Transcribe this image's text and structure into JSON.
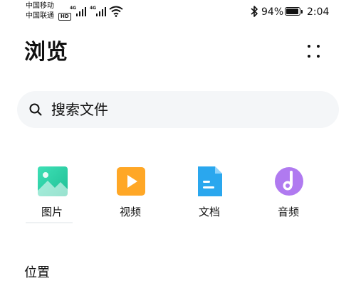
{
  "status_bar": {
    "carrier_1": "中国移动",
    "carrier_2": "中国联通",
    "hd_badge": "HD",
    "signal_1_label": "4G",
    "signal_2_label": "4G",
    "battery_percent": "94%",
    "battery_level": 0.94,
    "time": "2:04"
  },
  "header": {
    "title": "浏览",
    "more_icon": "more-dots-icon"
  },
  "search": {
    "placeholder": "搜索文件",
    "icon": "search-icon"
  },
  "categories": [
    {
      "label": "图片",
      "icon": "image-icon",
      "color": "#2fd3a6"
    },
    {
      "label": "视频",
      "icon": "video-icon",
      "color": "#ffa726"
    },
    {
      "label": "文档",
      "icon": "document-icon",
      "color": "#2aa7ee"
    },
    {
      "label": "音频",
      "icon": "audio-icon",
      "color": "#b07af0"
    }
  ],
  "sections": {
    "location_title": "位置"
  }
}
